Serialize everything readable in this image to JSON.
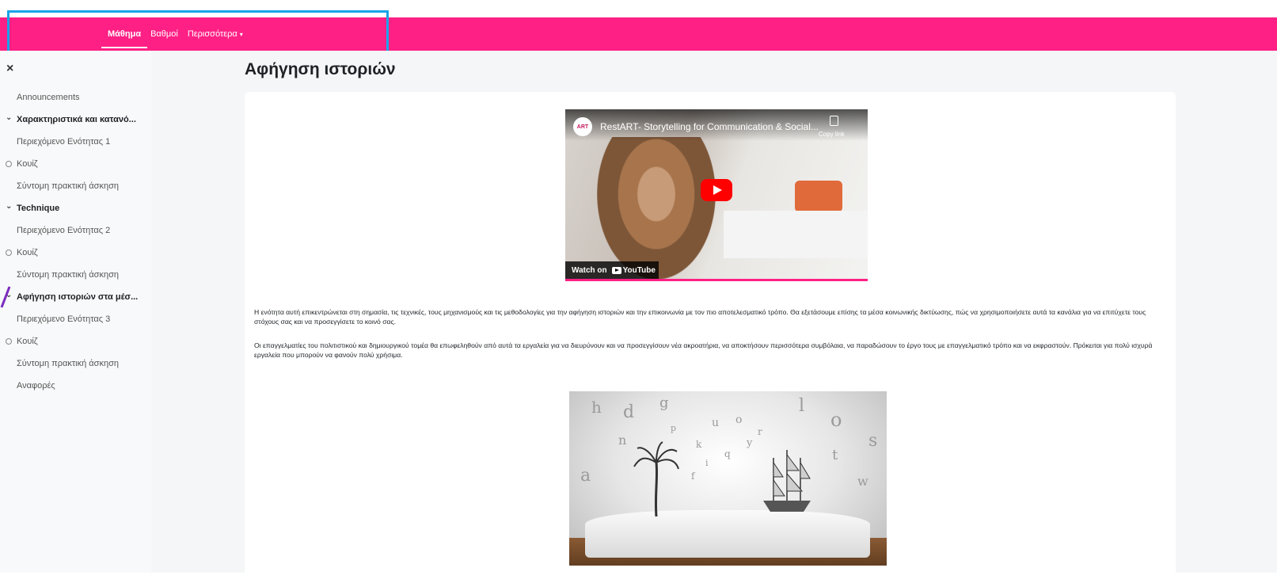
{
  "navbar": {
    "items": [
      {
        "label": "Μάθημα",
        "active": true
      },
      {
        "label": "Βαθμοί",
        "active": false
      },
      {
        "label": "Περισσότερα",
        "active": false,
        "has_dropdown": true
      }
    ],
    "background": "#ff2085",
    "highlight_color": "#1aa3e8"
  },
  "sidebar": {
    "close_symbol": "×",
    "items": [
      {
        "label": "Announcements",
        "type": "link"
      },
      {
        "label": "Χαρακτηριστικά και κατανό...",
        "type": "section"
      },
      {
        "label": "Περιεχόμενο Ενότητας 1",
        "type": "link"
      },
      {
        "label": "Κουίζ",
        "type": "quiz"
      },
      {
        "label": "Σύντομη πρακτική άσκηση",
        "type": "link"
      },
      {
        "label": "Technique",
        "type": "section"
      },
      {
        "label": "Περιεχόμενο Ενότητας 2",
        "type": "link"
      },
      {
        "label": "Κουίζ",
        "type": "quiz"
      },
      {
        "label": "Σύντομη πρακτική άσκηση",
        "type": "link"
      },
      {
        "label": "Αφήγηση ιστοριών στα μέσ...",
        "type": "section"
      },
      {
        "label": "Περιεχόμενο Ενότητας 3",
        "type": "link"
      },
      {
        "label": "Κουίζ",
        "type": "quiz"
      },
      {
        "label": "Σύντομη πρακτική άσκηση",
        "type": "link"
      },
      {
        "label": "Αναφορές",
        "type": "link"
      }
    ]
  },
  "main": {
    "title": "Αφήγηση ιστοριών",
    "video": {
      "channel_logo": "ART",
      "title": "RestART- Storytelling for Communication & Social...",
      "copy_link": "Copy link",
      "watch_on": "Watch on",
      "youtube": "YouTube"
    },
    "paragraphs": [
      "Η ενότητα αυτή επικεντρώνεται στη σημασία, τις τεχνικές, τους μηχανισμούς και τις μεθοδολογίες για την αφήγηση ιστοριών και την επικοινωνία με τον πιο αποτελεσματικό τρόπο. Θα εξετάσουμε επίσης τα μέσα κοινωνικής δικτύωσης, πώς να χρησιμοποιήσετε αυτά τα κανάλια για να επιτύχετε τους στόχους σας και να προσεγγίσετε το κοινό σας.",
      "Οι επαγγελματίες του πολιτιστικού και δημιουργικού τομέα θα επωφεληθούν από αυτά τα εργαλεία για να διευρύνουν και να προσεγγίσουν νέα ακροατήρια, να αποκτήσουν περισσότερα συμβόλαια, να παραδώσουν το έργο τους με επαγγελματικό τρόπο και να εκφραστούν. Πρόκειται για πολύ ισχυρά εργαλεία που μπορούν να φανούν πολύ χρήσιμα."
    ],
    "illustration_letters": [
      "h",
      "d",
      "g",
      "l",
      "o",
      "n",
      "p",
      "u",
      "o",
      "r",
      "k",
      "y",
      "q",
      "t",
      "s",
      "i",
      "a",
      "f",
      "w"
    ]
  }
}
